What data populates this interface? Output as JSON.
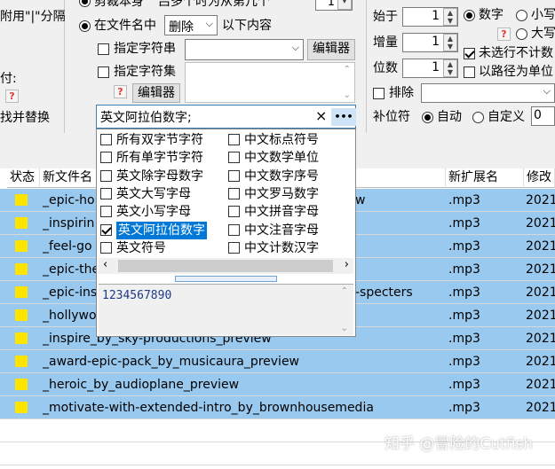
{
  "left_panel": {
    "separator_hint": "附用\"|\"分隔",
    "partial_label": "付:",
    "help": "?",
    "find_replace": "找并替换"
  },
  "cut_group": {
    "cut_self_label": "剪裁本身",
    "cut_partial": "吕多个时为从第几个",
    "cut_count": "1",
    "in_filename_label": "在文件名中",
    "mode_value": "删除",
    "after_text": "以下内容",
    "specify_string_label": "指定字符串",
    "specify_charset_label": "指定字符集",
    "editor_label": "编辑器",
    "editor2_label": "编辑器",
    "help": "?"
  },
  "numbering": {
    "start_label": "始于",
    "start_value": "1",
    "step_label": "增量",
    "step_value": "1",
    "digits_label": "位数",
    "digits_value": "1",
    "exclude_label": "排除",
    "pad_label": "补位符",
    "auto_label": "自动",
    "custom_label": "自定义",
    "custom_value": "0",
    "digit_label": "数字",
    "lower_label": "小写",
    "upper_label": "大写",
    "unselected_label": "未选行不计数",
    "by_path_label": "以路径为单位",
    "help": "?"
  },
  "charset_dropdown": {
    "current": "英文阿拉伯数字;",
    "clear": "×",
    "more": "•••",
    "options_left": [
      {
        "label": "所有双字节字符",
        "checked": false
      },
      {
        "label": "所有单字节字符",
        "checked": false
      },
      {
        "label": "英文除字母数字",
        "checked": false
      },
      {
        "label": "英文大写字母",
        "checked": false
      },
      {
        "label": "英文小写字母",
        "checked": false
      },
      {
        "label": "英文阿拉伯数字",
        "checked": true
      },
      {
        "label": "英文符号",
        "checked": false
      }
    ],
    "options_right": [
      {
        "label": "中文标点符号",
        "checked": false
      },
      {
        "label": "中文数学单位",
        "checked": false
      },
      {
        "label": "中文数字序号",
        "checked": false
      },
      {
        "label": "中文罗马数字",
        "checked": false
      },
      {
        "label": "中文拼音字母",
        "checked": false
      },
      {
        "label": "中文注音字母",
        "checked": false
      },
      {
        "label": "中文计数汉字",
        "checked": false
      }
    ],
    "preview": "1234567890"
  },
  "table": {
    "headers": [
      "状态",
      "新文件名",
      "新扩展名",
      "修改"
    ],
    "rows": [
      {
        "name": "_epic-ho",
        "tail": "w",
        "ext": ".mp3",
        "date": "2021"
      },
      {
        "name": "_inspirin",
        "tail": "",
        "ext": ".mp3",
        "date": "2021"
      },
      {
        "name": "_feel-go",
        "tail": "",
        "ext": ".mp3",
        "date": "2021"
      },
      {
        "name": "_epic-the",
        "tail": "",
        "ext": ".mp3",
        "date": "2021"
      },
      {
        "name": "_epic-ins",
        "tail": "-specters",
        "ext": ".mp3",
        "date": "2021"
      },
      {
        "name": "_hollywo",
        "tail": "",
        "ext": ".mp3",
        "date": "2021"
      },
      {
        "name": "_inspire_by_sky-productions_preview",
        "tail": "",
        "ext": ".mp3",
        "date": "2021"
      },
      {
        "name": "_award-epic-pack_by_musicaura_preview",
        "tail": "",
        "ext": ".mp3",
        "date": "2021"
      },
      {
        "name": "_heroic_by_audioplane_preview",
        "tail": "",
        "ext": ".mp3",
        "date": "2021"
      },
      {
        "name": "_motivate-with-extended-intro_by_brownhousemedia",
        "tail": "",
        "ext": ".mp3",
        "date": "2021"
      }
    ]
  },
  "watermark": "知乎 @冒险的Cutfish",
  "colors": {
    "selection": "#99c9ef",
    "folder": "#ffe400",
    "highlight": "#0078d7",
    "help_red": "#e53935"
  }
}
